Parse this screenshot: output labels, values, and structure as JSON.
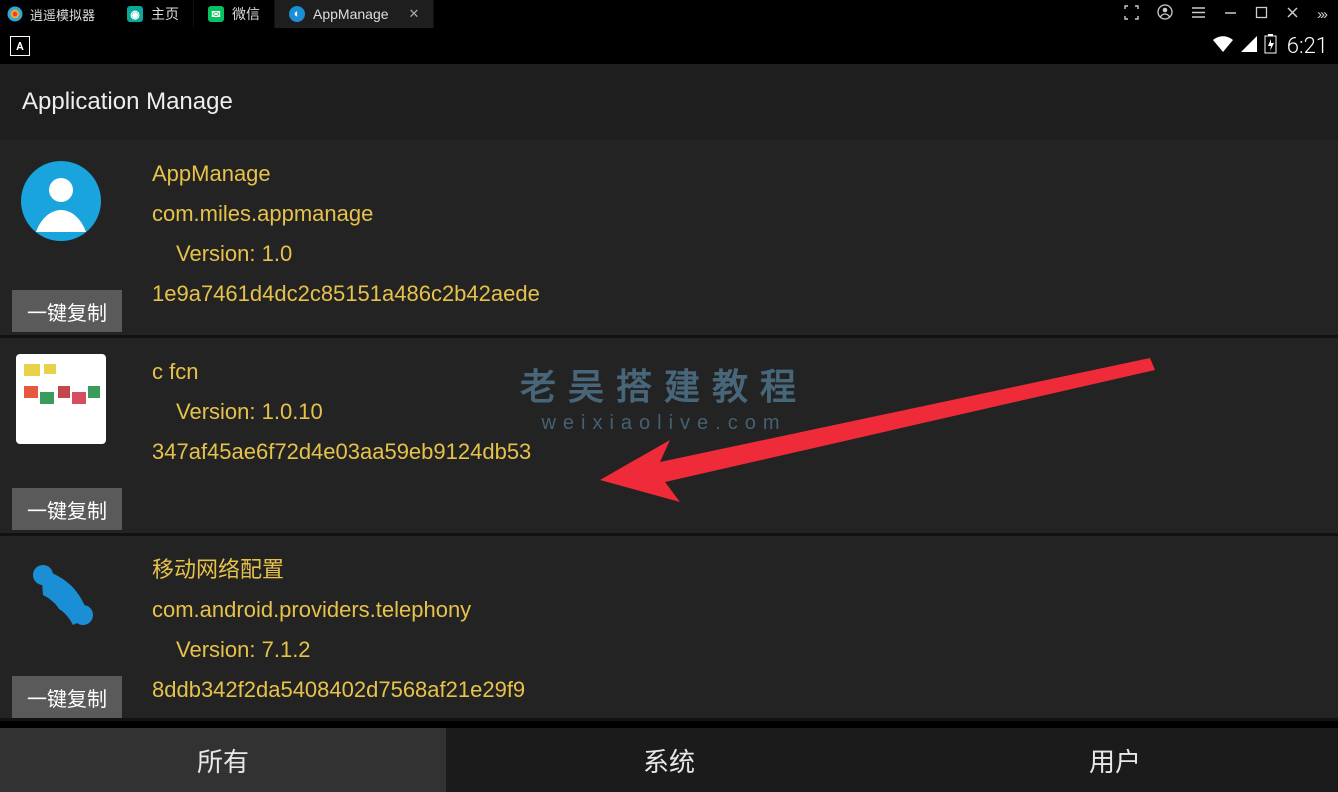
{
  "emulator": {
    "title": "逍遥模拟器",
    "tabs": [
      {
        "label": "主页",
        "favicon_bg": "#0aa89a",
        "favicon_txt": "",
        "active": false
      },
      {
        "label": "微信",
        "favicon_bg": "#07c160",
        "favicon_txt": "",
        "active": false
      },
      {
        "label": "AppManage",
        "favicon_bg": "#1b8fd6",
        "favicon_txt": "",
        "active": true
      }
    ]
  },
  "statusbar": {
    "clock": "6:21"
  },
  "page": {
    "title": "Application Manage"
  },
  "apps": [
    {
      "name": "AppManage",
      "pkg": "com.miles.appmanage",
      "ver": "Version: 1.0",
      "sig": "1e9a7461d4dc2c85151a486c2b42aede",
      "copy": "一键复制",
      "icon_kind": "circle-blue"
    },
    {
      "name": "",
      "pkg": "c             fcn",
      "ver": "Version: 1.0.10",
      "sig": "347af45ae6f72d4e03aa59eb9124db53",
      "copy": "一键复制",
      "icon_kind": "pixelated"
    },
    {
      "name": "移动网络配置",
      "pkg": "com.android.providers.telephony",
      "ver": "Version: 7.1.2",
      "sig": "8ddb342f2da5408402d7568af21e29f9",
      "copy": "一键复制",
      "icon_kind": "phone-blue"
    }
  ],
  "bottom_nav": {
    "all": "所有",
    "system": "系统",
    "user": "用户"
  },
  "watermark": {
    "line1": "老吴搭建教程",
    "line2": "weixiaolive.com"
  }
}
